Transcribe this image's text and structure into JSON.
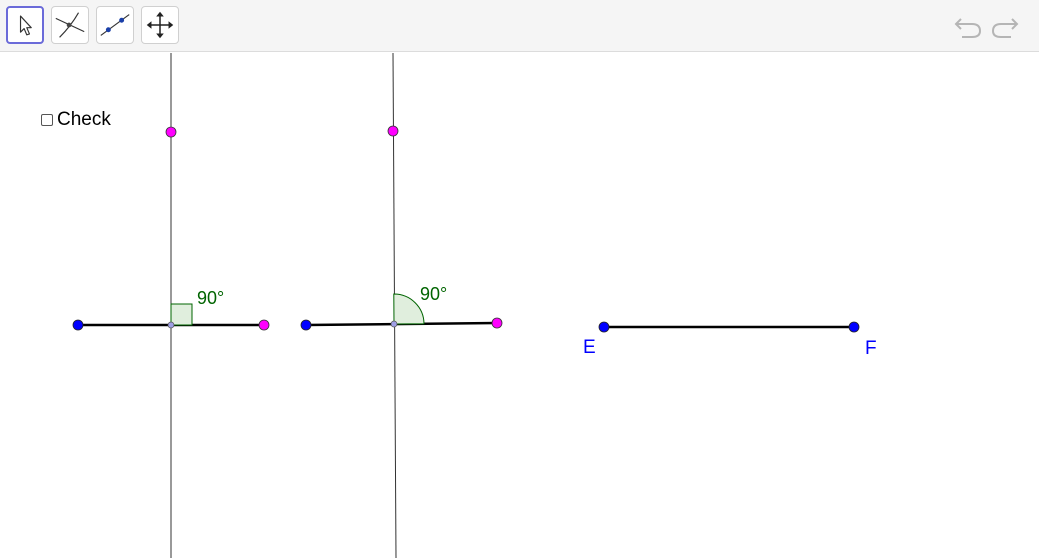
{
  "toolbar": {
    "tools": [
      {
        "icon": "move-pointer-icon",
        "active": true
      },
      {
        "icon": "intersect-icon",
        "active": false
      },
      {
        "icon": "point-on-object-icon",
        "active": false
      },
      {
        "icon": "move-graphics-view-icon",
        "active": false
      }
    ],
    "undo_icon": "undo-icon",
    "redo_icon": "redo-icon"
  },
  "check": {
    "label": "Check",
    "checked": false
  },
  "figures": {
    "angle1_label": "90°",
    "angle2_label": "90°",
    "point_e_label": "E",
    "point_f_label": "F"
  },
  "colors": {
    "blue_point": "#0000ff",
    "magenta_point": "#ff00ff",
    "angle_label": "#006400",
    "point_label": "#0000ff",
    "tool_active_border": "#6b6bd9"
  }
}
